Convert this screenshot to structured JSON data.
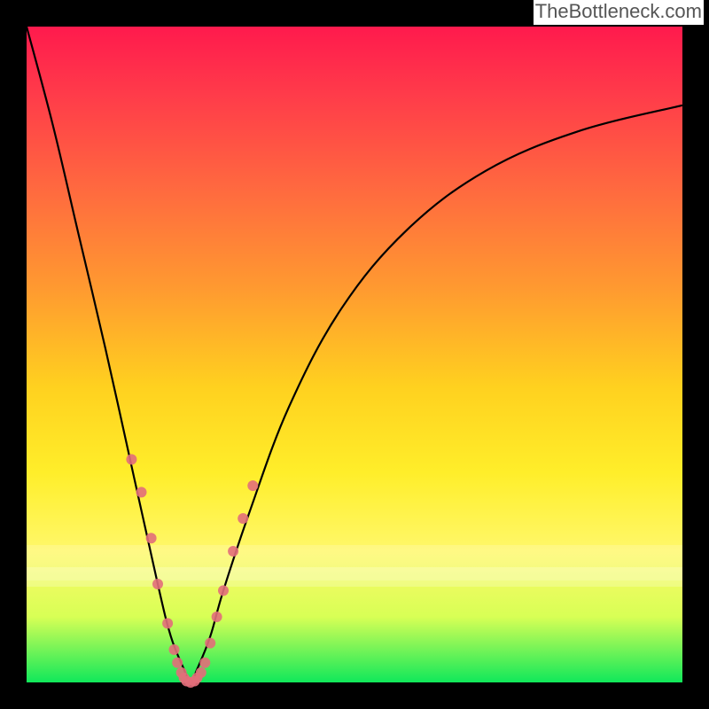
{
  "watermark": "TheBottleneck.com",
  "chart_data": {
    "type": "line",
    "title": "",
    "xlabel": "",
    "ylabel": "",
    "xlim": [
      0,
      100
    ],
    "ylim": [
      0,
      100
    ],
    "series": [
      {
        "name": "curve",
        "x": [
          0,
          4,
          8,
          12,
          16,
          20,
          22,
          24,
          25,
          26,
          28,
          30,
          34,
          40,
          48,
          58,
          70,
          84,
          100
        ],
        "y": [
          100,
          85,
          68,
          51,
          33,
          15,
          7,
          2,
          0,
          2,
          7,
          14,
          26,
          42,
          57,
          69,
          78,
          84,
          88
        ]
      }
    ],
    "marker_points": {
      "name": "markers",
      "note": "approximate scatter markers along lower part of curve",
      "x": [
        16,
        17.5,
        19,
        20,
        21.5,
        22.5,
        23,
        23.6,
        24,
        24.4,
        25,
        25.6,
        26,
        26.6,
        27.2,
        28,
        29,
        30,
        31.5,
        33,
        34.5
      ],
      "y": [
        34,
        29,
        22,
        15,
        9,
        5,
        3,
        1.5,
        0.7,
        0.2,
        0,
        0.2,
        0.7,
        1.5,
        3,
        6,
        10,
        14,
        20,
        25,
        30
      ],
      "color": "#e26e7a",
      "radius": 6
    },
    "background_gradient": {
      "top": "#ff1a4d",
      "bottom": "#10e85a"
    }
  }
}
